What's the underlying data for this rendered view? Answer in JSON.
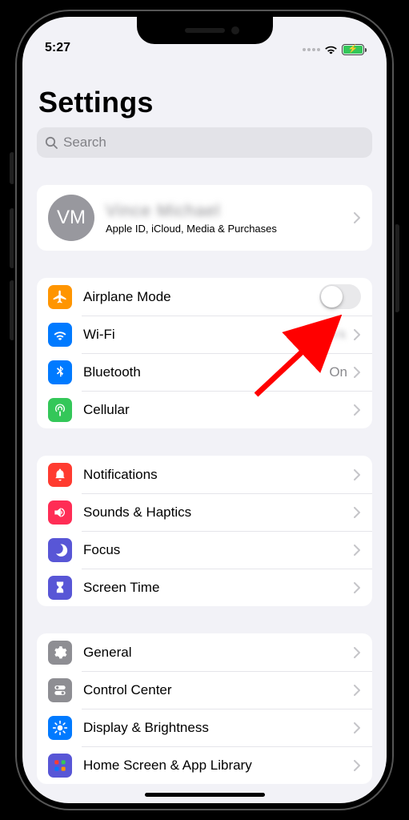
{
  "status": {
    "time": "5:27"
  },
  "header": {
    "title": "Settings"
  },
  "search": {
    "placeholder": "Search"
  },
  "account": {
    "initials": "VM",
    "name_blurred": "Vince Michael",
    "subtitle": "Apple ID, iCloud, Media & Purchases"
  },
  "groups": [
    {
      "rows": [
        {
          "id": "airplane",
          "label": "Airplane Mode",
          "icon": "airplane",
          "color": "c-orange",
          "type": "toggle",
          "on": false
        },
        {
          "id": "wifi",
          "label": "Wi-Fi",
          "icon": "wifi",
          "color": "c-blue",
          "type": "nav",
          "value_blurred": "Network"
        },
        {
          "id": "bluetooth",
          "label": "Bluetooth",
          "icon": "bluetooth",
          "color": "c-blue",
          "type": "nav",
          "value": "On"
        },
        {
          "id": "cellular",
          "label": "Cellular",
          "icon": "antenna",
          "color": "c-green",
          "type": "nav"
        }
      ]
    },
    {
      "rows": [
        {
          "id": "notifications",
          "label": "Notifications",
          "icon": "bell",
          "color": "c-red",
          "type": "nav"
        },
        {
          "id": "sounds",
          "label": "Sounds & Haptics",
          "icon": "speaker",
          "color": "c-pink",
          "type": "nav"
        },
        {
          "id": "focus",
          "label": "Focus",
          "icon": "moon",
          "color": "c-indigo",
          "type": "nav"
        },
        {
          "id": "screentime",
          "label": "Screen Time",
          "icon": "hourglass",
          "color": "c-indigo",
          "type": "nav"
        }
      ]
    },
    {
      "rows": [
        {
          "id": "general",
          "label": "General",
          "icon": "gear",
          "color": "c-gray",
          "type": "nav"
        },
        {
          "id": "controlcenter",
          "label": "Control Center",
          "icon": "switches",
          "color": "c-gray",
          "type": "nav"
        },
        {
          "id": "display",
          "label": "Display & Brightness",
          "icon": "sun",
          "color": "c-bluel",
          "type": "nav"
        },
        {
          "id": "homescreen",
          "label": "Home Screen & App Library",
          "icon": "grid",
          "color": "c-indigo",
          "type": "nav"
        }
      ]
    }
  ]
}
